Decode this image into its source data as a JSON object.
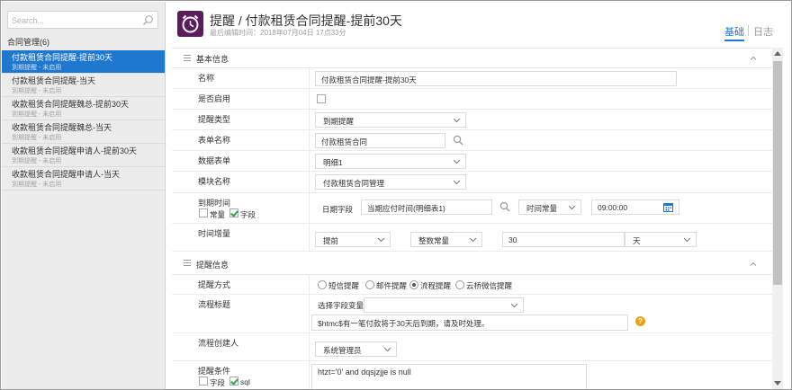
{
  "sidebar": {
    "search_placeholder": "Search...",
    "group_title": "合同管理(6)",
    "items": [
      {
        "title": "付款租赁合同提醒-提前30天",
        "status": "到期提醒 - 未启用",
        "active": true
      },
      {
        "title": "付款租赁合同提醒-当天",
        "status": "到期提醒 - 未启用",
        "active": false
      },
      {
        "title": "收款租赁合同提醒魏总-提前30天",
        "status": "到期提醒 - 未启用",
        "active": false
      },
      {
        "title": "收款租赁合同提醒魏总-当天",
        "status": "到期提醒 - 未启用",
        "active": false
      },
      {
        "title": "收款租赁合同提醒申请人-提前30天",
        "status": "到期提醒 - 未启用",
        "active": false
      },
      {
        "title": "收款租赁合同提醒申请人-当天",
        "status": "到期提醒 - 未启用",
        "active": false
      }
    ]
  },
  "header": {
    "title": "提醒 / 付款租赁合同提醒-提前30天",
    "subtitle": "最后编辑时间：2018年07月04日 17点33分",
    "tabs": {
      "basic": "基础",
      "log": "日志"
    }
  },
  "basic_section": {
    "title": "基本信息",
    "name": {
      "label": "名称",
      "value": "付款租赁合同提醒-提前30天"
    },
    "enabled": {
      "label": "是否启用",
      "checked": false
    },
    "reminder_type": {
      "label": "提醒类型",
      "value": "到期提醒"
    },
    "form_name": {
      "label": "表单名称",
      "value": "付款租赁合同"
    },
    "data_table": {
      "label": "数据表单",
      "value": "明细1"
    },
    "module_name": {
      "label": "模块名称",
      "value": "付款租赁合同管理"
    },
    "due_time": {
      "label": "到期时间",
      "opt_constant": "常量",
      "opt_field": "字段",
      "date_field_label": "日期字段",
      "date_field_value": "当期应付时间(明细表1)",
      "time_mode": "时间常量",
      "time_value": "09:00:00"
    },
    "time_increment": {
      "label": "时间增量",
      "direction": "提前",
      "num_type": "整数常量",
      "amount": "30",
      "unit": "天"
    }
  },
  "remind_section": {
    "title": "提醒信息",
    "method": {
      "label": "提醒方式",
      "options": [
        "短信提醒",
        "邮件提醒",
        "流程提醒",
        "云桥微信提醒"
      ],
      "selected": 2
    },
    "flow_title": {
      "label": "流程标题",
      "select_var_label": "选择字段变量：",
      "text": "$htmc$有一笔付款将于30天后到期，请及时处理。",
      "help_icon": "?"
    },
    "creator": {
      "label": "流程创建人",
      "value": "系统管理员"
    },
    "condition": {
      "label": "提醒条件",
      "opt_field": "字段",
      "opt_sql": "sql",
      "value": "htzt='0' and dqsjzjje is null"
    }
  },
  "colors": {
    "accent": "#1e78cf",
    "app_icon_bg": "#5a1c5d",
    "help": "#e8a317"
  }
}
